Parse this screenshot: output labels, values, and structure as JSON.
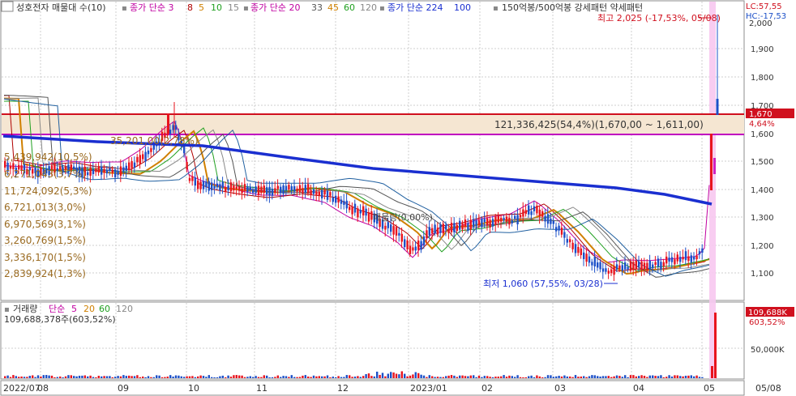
{
  "legend": {
    "stock": "성호전자 매물대 수(10)",
    "sma1_label": "종가 단순 3",
    "sma1_periods": [
      "8",
      "5",
      "10",
      "15"
    ],
    "sma2_label": "종가 단순 20",
    "sma2_periods": [
      "33",
      "45",
      "60",
      "120"
    ],
    "sma3_label": "종가 단순 224",
    "sma3_period": "100",
    "pattern": "150억봉/500억봉 강세패턴 약세패턴"
  },
  "right_top": {
    "lc": "LC:57,55",
    "hc": "HC:-17,53"
  },
  "price_axis": [
    "1,900",
    "1,800",
    "1,700",
    "1,600",
    "1,500",
    "1,400",
    "1,300",
    "1,200",
    "1,100"
  ],
  "price_axis_top": "2,000",
  "current_price": {
    "label": "1,670",
    "pct": "4,64%"
  },
  "high_annotation": "최고 2,025 (-17,53%, 05/08)",
  "low_annotation": "최저 1,060 (57,55%, 03/28)",
  "band_annotation": "121,336,425(54,4%)(1,670,00 ~ 1,611,00)",
  "band_small": "35,201,00(2,78%)",
  "band_small2": "매물량(0,00%)",
  "volume_profile": [
    "5,439,942(10,5%)",
    "6,271,043(3,7%)",
    "11,724,092(5,3%)",
    "6,721,013(3,0%)",
    "6,970,569(3,1%)",
    "3,260,769(1,5%)",
    "3,336,170(1,5%)",
    "2,839,924(1,3%)"
  ],
  "volume_legend": {
    "label": "거래량",
    "sma_label": "단순",
    "periods": [
      "5",
      "20",
      "60",
      "120"
    ],
    "value": "109,688,378주(603,52%)"
  },
  "volume_axis": {
    "tick": "50,000K",
    "current": "109,688K",
    "pct": "603,52%"
  },
  "x_axis": [
    "2022/07",
    "08",
    "09",
    "10",
    "11",
    "12",
    "2023/01",
    "02",
    "03",
    "04",
    "05",
    "05/08"
  ],
  "colors": {
    "up": "#e8141e",
    "down": "#1c50c8",
    "ma224": "#1a2fd0",
    "band": "#f5e6d2",
    "redline": "#d0101e",
    "magline": "#c000c0",
    "highlight": "#f7c8f0"
  }
}
